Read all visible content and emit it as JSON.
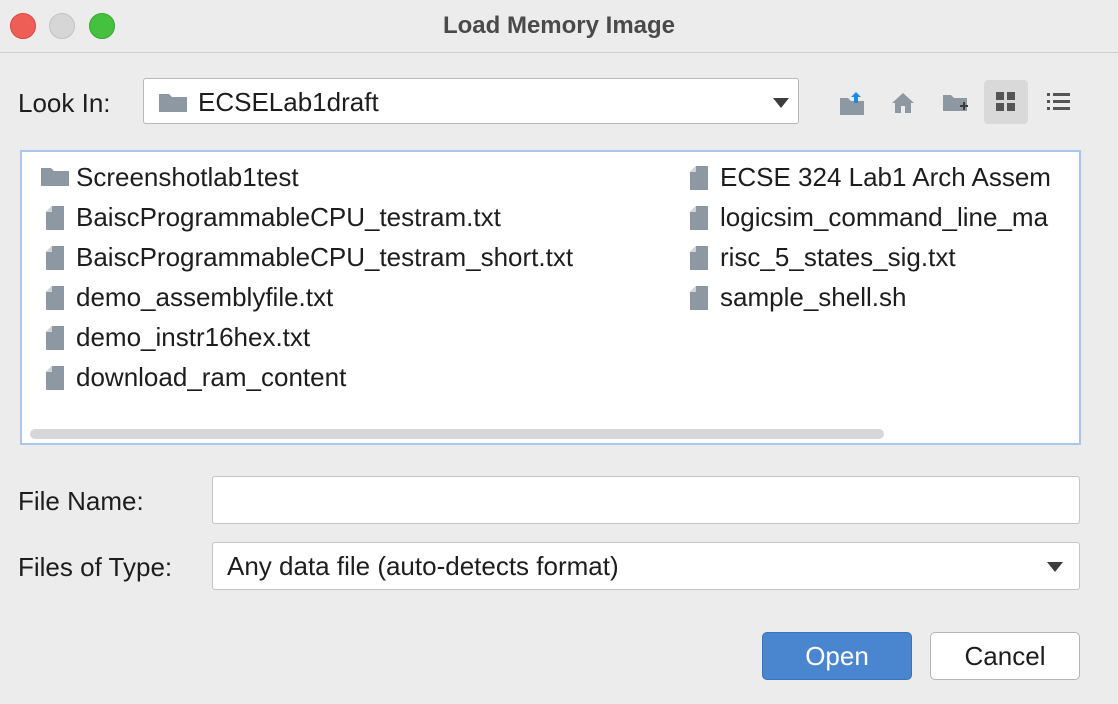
{
  "window": {
    "title": "Load Memory Image"
  },
  "look_in": {
    "label": "Look In:",
    "value": "ECSELab1draft"
  },
  "toolbar": {
    "icons": [
      "up-folder-icon",
      "home-icon",
      "new-folder-icon",
      "grid-view-icon",
      "list-view-icon"
    ]
  },
  "files": {
    "column1": [
      {
        "name": "Screenshotlab1test",
        "type": "folder"
      },
      {
        "name": "BaiscProgrammableCPU_testram.txt",
        "type": "file"
      },
      {
        "name": "BaiscProgrammableCPU_testram_short.txt",
        "type": "file"
      },
      {
        "name": "demo_assemblyfile.txt",
        "type": "file"
      },
      {
        "name": "demo_instr16hex.txt",
        "type": "file"
      },
      {
        "name": "download_ram_content",
        "type": "file"
      }
    ],
    "column2": [
      {
        "name": "ECSE 324 Lab1 Arch Assem",
        "type": "file"
      },
      {
        "name": "logicsim_command_line_ma",
        "type": "file"
      },
      {
        "name": "risc_5_states_sig.txt",
        "type": "file"
      },
      {
        "name": "sample_shell.sh",
        "type": "file"
      }
    ]
  },
  "file_name": {
    "label": "File Name:",
    "value": ""
  },
  "files_of_type": {
    "label": "Files of Type:",
    "value": "Any data file (auto-detects format)"
  },
  "buttons": {
    "open": "Open",
    "cancel": "Cancel"
  },
  "colors": {
    "accent": "#4a86cf",
    "list_border": "#a7c7ee",
    "icon_gray": "#8e98a2",
    "active_icon": "#1f8ae0"
  }
}
